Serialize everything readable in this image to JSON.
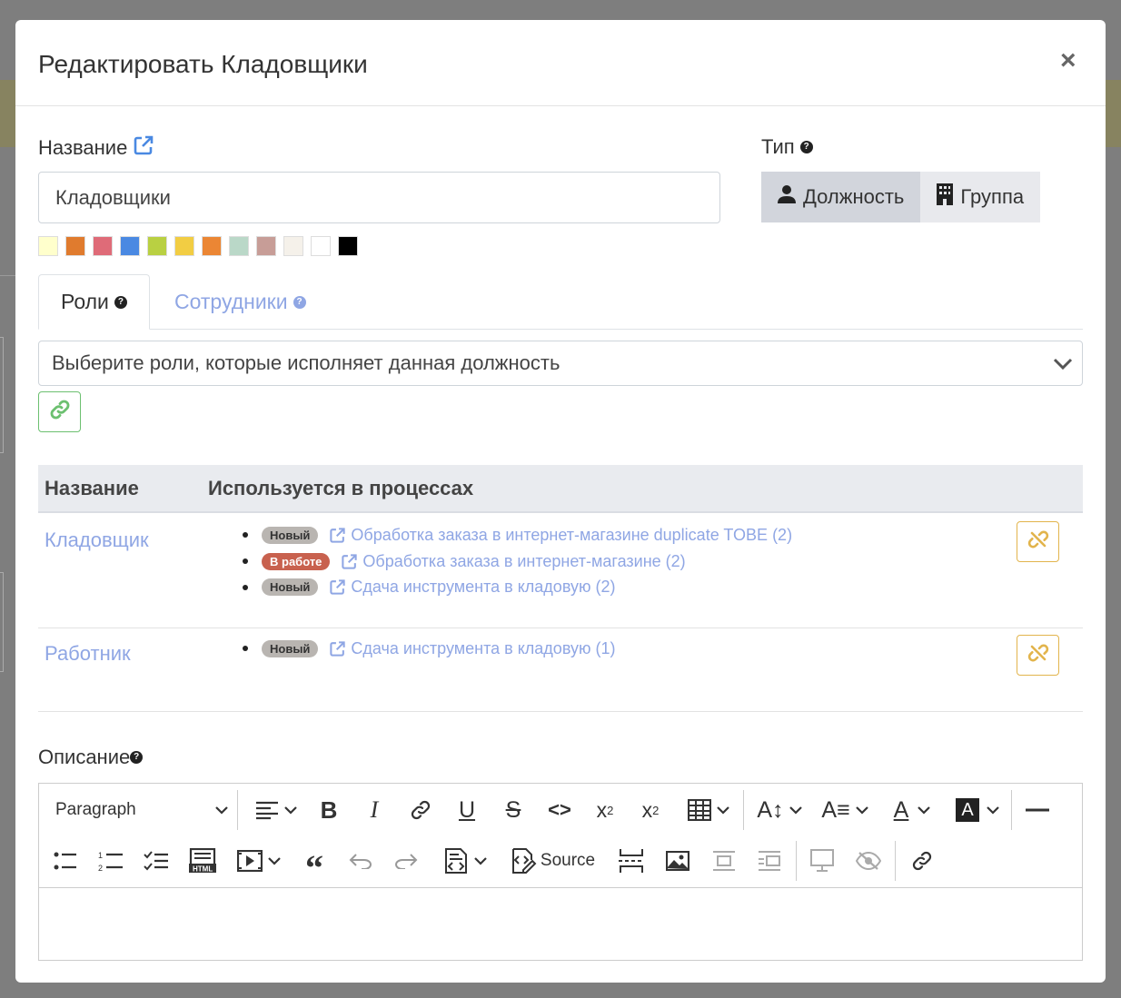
{
  "modal": {
    "title": "Редактировать Кладовщики",
    "close": "×"
  },
  "name_field": {
    "label": "Название",
    "value": "Кладовщики"
  },
  "swatch_colors": [
    "#ffffcc",
    "#e07b2e",
    "#df6b78",
    "#4a89e2",
    "#b9d042",
    "#f2cd43",
    "#eb8634",
    "#bad8c8",
    "#c79d97",
    "#f5f1ea",
    "#ffffff",
    "#000000"
  ],
  "type_field": {
    "label": "Тип",
    "options": [
      {
        "label": "Должность",
        "icon": "user-icon",
        "active": true
      },
      {
        "label": "Группа",
        "icon": "building-icon",
        "active": false
      }
    ]
  },
  "tabs": [
    {
      "label": "Роли",
      "active": true
    },
    {
      "label": "Сотрудники",
      "active": false
    }
  ],
  "roles_select": {
    "placeholder": "Выберите роли, которые исполняет данная должность"
  },
  "table": {
    "headers": [
      "Название",
      "Используется в процессах"
    ],
    "rows": [
      {
        "name": "Кладовщик",
        "processes": [
          {
            "status": "Новый",
            "status_color": "#b9b5b1",
            "title": "Обработка заказа в интернет-магазине duplicate TOBE (2)"
          },
          {
            "status": "В работе",
            "status_color": "#c8614e",
            "title": "Обработка заказа в интернет-магазине (2)"
          },
          {
            "status": "Новый",
            "status_color": "#b9b5b1",
            "title": "Сдача инструмента в кладовую (2)"
          }
        ]
      },
      {
        "name": "Работник",
        "processes": [
          {
            "status": "Новый",
            "status_color": "#b9b5b1",
            "title": "Сдача инструмента в кладовую (1)"
          }
        ]
      }
    ]
  },
  "description": {
    "label": "Описание"
  },
  "editor": {
    "paragraph_label": "Paragraph",
    "source_label": "Source"
  },
  "colors": {
    "accent": "#8fa6e4",
    "success": "#6cc070",
    "warning": "#e2b44c",
    "danger": "#c8614e"
  }
}
